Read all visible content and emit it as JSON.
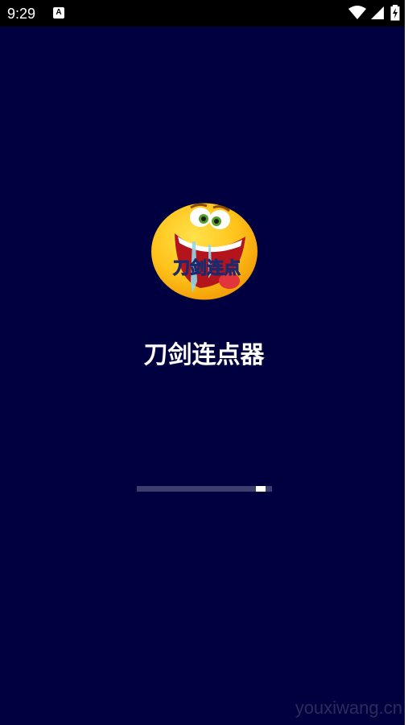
{
  "status_bar": {
    "time": "9:29",
    "notification_icon": "a-square-icon",
    "wifi_icon": "wifi-icon",
    "signal_icon": "cell-signal-icon",
    "battery_icon": "battery-charging-icon"
  },
  "splash": {
    "logo_text": "刀剑连点",
    "title": "刀剑连点器",
    "progress": 0.95
  },
  "watermark": "youxiwang.cn",
  "colors": {
    "background": "#000040",
    "status_bar": "#000000",
    "title_text": "#ffffff",
    "progress_track": "#3b3f6e",
    "progress_indicator": "#ffffff"
  }
}
